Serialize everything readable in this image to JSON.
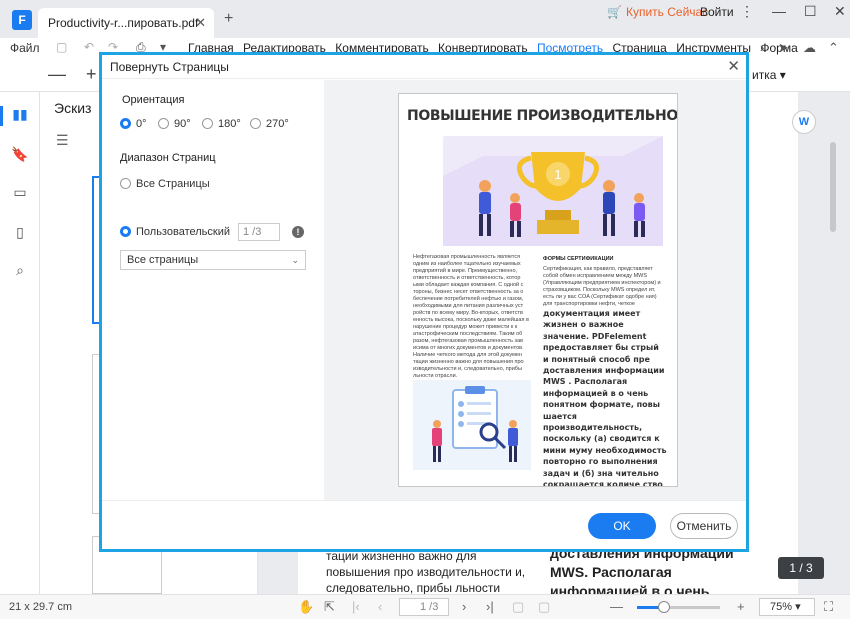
{
  "window": {
    "tab_title": "Productivity-r...пировать.pdf",
    "buy_label": "Купить Сейчас",
    "login_label": "Войти"
  },
  "menu": {
    "file_label": "Файл",
    "items": [
      "Главная",
      "Редактировать",
      "Комментировать",
      "Конвертировать",
      "Посмотреть",
      "Страница",
      "Инструменты",
      "Форма"
    ],
    "active_index": 4
  },
  "toolbar": {
    "edit_label": "итка"
  },
  "thumbnails": {
    "panel_title": "Эскиз"
  },
  "background_page": {
    "left_text": "тации жизненно важно для повышения про изводительности и, следовательно, прибы льности отрасли.",
    "right_text": "доставления информации MWS. Располагая информацией в о чень понятном формате, повы"
  },
  "page_badge": "1 / 3",
  "statusbar": {
    "dimensions": "21 x 29.7 cm",
    "page_input": "1 /3",
    "zoom_label": "75%",
    "zoom_fraction": 0.33
  },
  "dialog": {
    "title": "Повернуть Страницы",
    "orientation_label": "Ориентация",
    "orientations": [
      "0°",
      "90°",
      "180°",
      "270°"
    ],
    "selected_orientation": 0,
    "range_label": "Диапазон Страниц",
    "all_pages_label": "Все Страницы",
    "custom_label": "Пользовательский",
    "custom_page_placeholder": "1 /3",
    "subset_select": "Все страницы",
    "ok_label": "OK",
    "cancel_label": "Отменить"
  },
  "preview": {
    "title": "ПОВЫШЕНИЕ ПРОИЗВОДИТЕЛЬНОСТИ",
    "trophy_number": "1",
    "left_col": "Нефтегазовая промышленность является одним из наиболее тщательно изучаемых предприятий в мире. Преимущественно, ответственность и ответственность, котор ыми обладает каждая компания. С одной с тороны, бизнес несет ответственность за о беспечение потребителей нефтью и газом, необходимыми для питания различных уст ройств по всему миру. Во-вторых, ответств енность высока, поскольку даже малейшая в нарушение процедур может привести к к атастрофическим последствиям. Таким об разом, нефтегазовая промышленность зав исима от многих документов и документов. Наличие четкого метода для этой докумен тации жизненно важно для повышения про изводительности и, следовательно, прибы льности отрасли.",
    "right_heading": "ФОРМЫ СЕРТИФИКАЦИИ",
    "right_col": "Сертификация, как правило, представляет собой обмен исправлением между MWS (Управляющим предприятием инспектором) и страховщиком. Поскольку MWS определ ит, есть ли у вас COA (Сертификат одобре ния) для транспортировки нефти, четкое",
    "right_big": "документация имеет жизнен о важное значение. PDFelement предоставляет бы стрый и понятный способ пре доставления информации MWS . Располагая информацией в о чень понятном формате, повы шается производительность, поскольку (а) сводится к мини муму необходимость повторно го выполнения задач и (б) зна чительно сокращается количе ство потерянных документов или неправильно понятых док ументов в виде PDF-формы а более доставляемых в шифрован виде."
  }
}
